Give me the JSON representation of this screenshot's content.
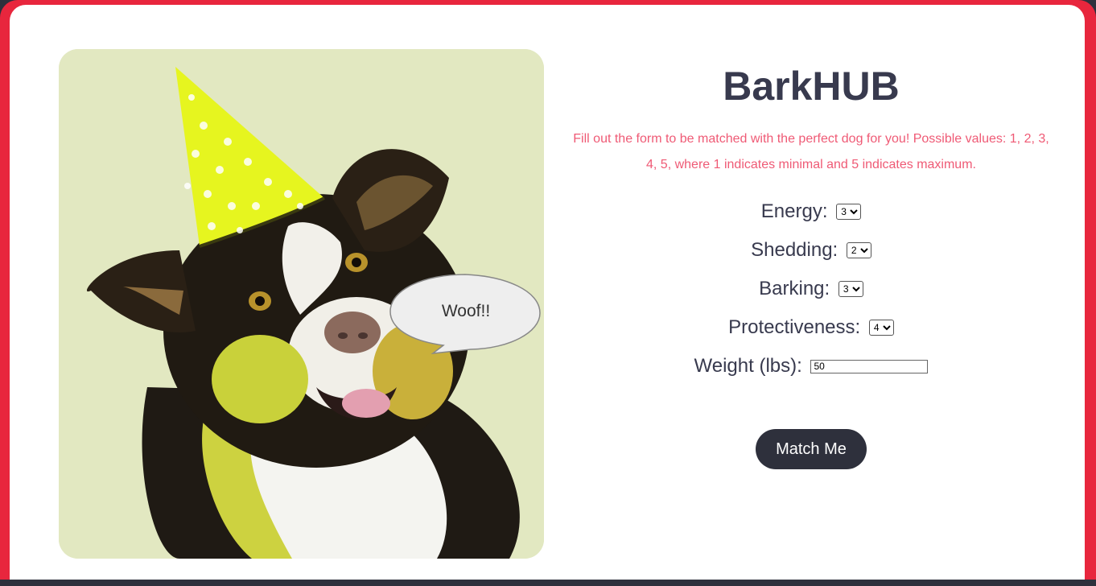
{
  "app": {
    "title": "BarkHUB",
    "intro": "Fill out the form to be matched with the perfect dog for you! Possible values: 1, 2, 3, 4, 5, where 1 indicates minimal and 5 indicates maximum."
  },
  "hero": {
    "speech_bubble": "Woof!!",
    "image_subject": "dog wearing yellow polka-dot party hat"
  },
  "form": {
    "energy": {
      "label": "Energy:",
      "value": "3",
      "options": [
        "1",
        "2",
        "3",
        "4",
        "5"
      ]
    },
    "shedding": {
      "label": "Shedding:",
      "value": "2",
      "options": [
        "1",
        "2",
        "3",
        "4",
        "5"
      ]
    },
    "barking": {
      "label": "Barking:",
      "value": "3",
      "options": [
        "1",
        "2",
        "3",
        "4",
        "5"
      ]
    },
    "protectiveness": {
      "label": "Protectiveness:",
      "value": "4",
      "options": [
        "1",
        "2",
        "3",
        "4",
        "5"
      ]
    },
    "weight": {
      "label": "Weight (lbs):",
      "value": "50"
    },
    "submit_label": "Match Me"
  },
  "colors": {
    "frame": "#e8263d",
    "title": "#383a4e",
    "intro": "#ef5a75",
    "button": "#2e303c",
    "photo_bg": "#e2e8c1",
    "hat": "#e6f51f"
  }
}
